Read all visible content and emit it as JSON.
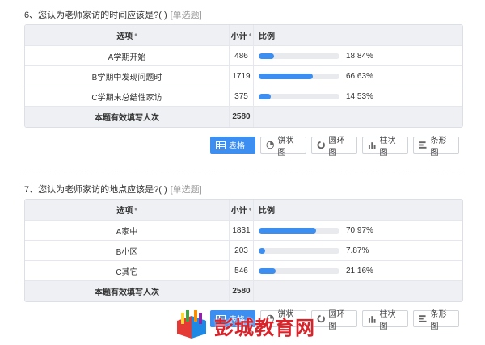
{
  "questions": [
    {
      "title": "6、您认为老师家访的时间应该是?( )",
      "qtype": "[单选题]",
      "headers": {
        "option": "选项",
        "count": "小计",
        "ratio": "比例",
        "sort": "♦"
      },
      "rows": [
        {
          "option": "A学期开始",
          "count": "486",
          "percent": "18.84%",
          "fill": 18.84
        },
        {
          "option": "B学期中发现问题时",
          "count": "1719",
          "percent": "66.63%",
          "fill": 66.63
        },
        {
          "option": "C学期末总结性家访",
          "count": "375",
          "percent": "14.53%",
          "fill": 14.53
        }
      ],
      "total": {
        "label": "本题有效填写人次",
        "count": "2580"
      }
    },
    {
      "title": "7、您认为老师家访的地点应该是?( )",
      "qtype": "[单选题]",
      "headers": {
        "option": "选项",
        "count": "小计",
        "ratio": "比例",
        "sort": "♦"
      },
      "rows": [
        {
          "option": "A家中",
          "count": "1831",
          "percent": "70.97%",
          "fill": 70.97
        },
        {
          "option": "B小区",
          "count": "203",
          "percent": "7.87%",
          "fill": 7.87
        },
        {
          "option": "C其它",
          "count": "546",
          "percent": "21.16%",
          "fill": 21.16
        }
      ],
      "total": {
        "label": "本题有效填写人次",
        "count": "2580"
      }
    }
  ],
  "view_buttons": {
    "table": "表格",
    "pie": "饼状图",
    "ring": "圆环图",
    "column": "柱状图",
    "strip": "条形图"
  },
  "watermark": {
    "text": "彭城教育网"
  },
  "colors": {
    "accent": "#3c8ef0",
    "header_bg": "#eef0f4",
    "watermark": "#d8232a"
  }
}
